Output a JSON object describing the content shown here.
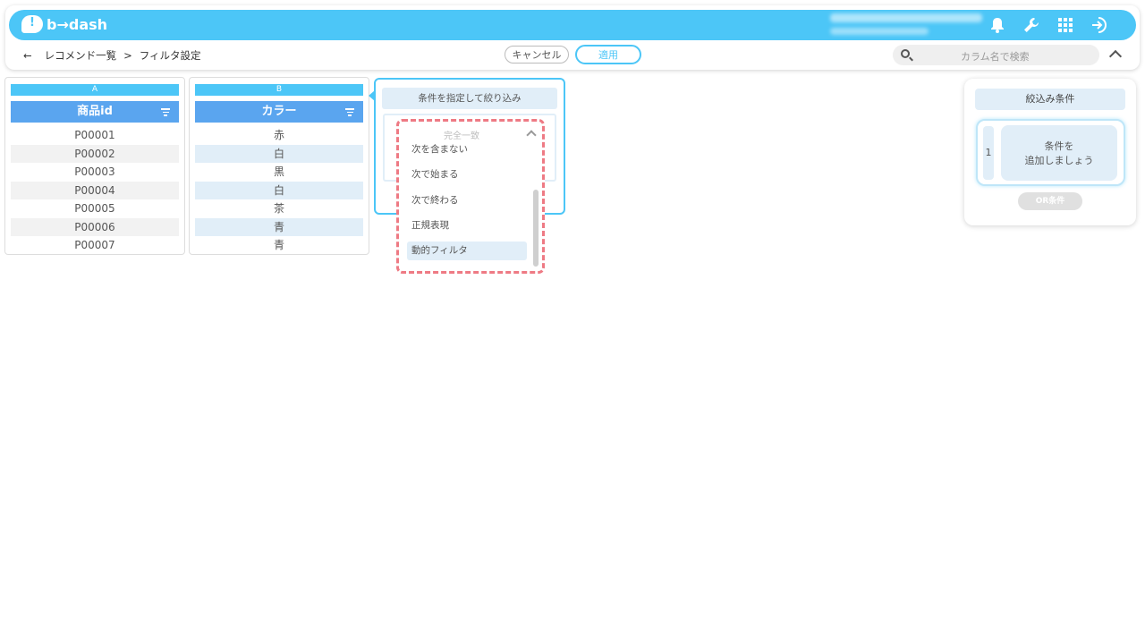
{
  "header": {
    "logo_text": "b→dash",
    "icons": [
      "bell-icon",
      "wrench-icon",
      "apps-grid-icon",
      "logout-icon"
    ]
  },
  "subheader": {
    "back_arrow": "←",
    "breadcrumb_parent": "レコメンド一覧",
    "breadcrumb_sep": ">",
    "breadcrumb_current": "フィルタ設定",
    "cancel_label": "キャンセル",
    "apply_label": "適用",
    "search_placeholder": "カラム名で検索"
  },
  "columns": [
    {
      "letter": "A",
      "header": "商品id",
      "rows": [
        "P00001",
        "P00002",
        "P00003",
        "P00004",
        "P00005",
        "P00006",
        "P00007"
      ]
    },
    {
      "letter": "B",
      "header": "カラー",
      "rows": [
        "赤",
        "白",
        "黒",
        "白",
        "茶",
        "青",
        "青"
      ]
    }
  ],
  "filter_panel": {
    "title": "条件を指定して絞り込み",
    "dropdown": {
      "selected": "完全一致",
      "items": [
        "次を含まない",
        "次で始まる",
        "次で終わる",
        "正規表現",
        "動的フィルタ"
      ],
      "highlighted_index": 4
    }
  },
  "conditions_panel": {
    "title": "絞込み条件",
    "group_number": "1",
    "add_line1": "条件を",
    "add_line2": "追加しましょう",
    "or_label": "OR条件"
  },
  "colors": {
    "accent": "#4cc6f7",
    "column_header": "#5aa5ef",
    "row_alt": "#f2f2f2",
    "row_alt_b": "#e1eef8",
    "dropdown_border": "#ee7a84"
  }
}
